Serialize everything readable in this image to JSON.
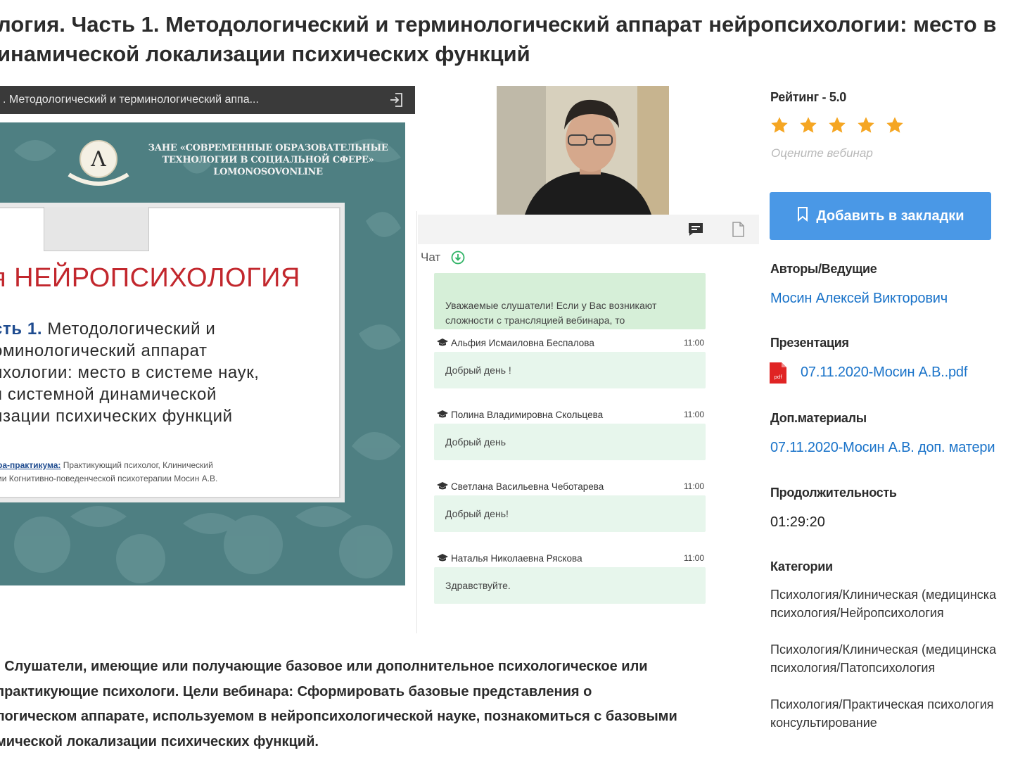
{
  "title": {
    "line1": "логия. Часть 1. Методологический и терминологический аппарат нейропсихологии: место в",
    "line2": "инамической локализации психических функций"
  },
  "player": {
    "bar_title": ". Методологический и терминологический аппа...",
    "slide": {
      "org_text": "ЗАНЕ «СОВРЕМЕННЫЕ ОБРАЗОВАТЕЛЬНЫЕ\nТЕХНОЛОГИИ В СОЦИАЛЬНОЙ СФЕРЕ»\nLOMONOSOVONLINE",
      "big_title": "я НЕЙРОПСИХОЛОГИЯ",
      "part_label": "сть 1.",
      "subtitle_rest": " Методологический и\nоминологический аппарат\nихологии: место в системе наук,\nя системной динамической\nизации психических функций",
      "author_label": "ра-практикума:",
      "author_text": " Практикующий психолог, Клинический\nии Когнитивно-поведенческой психотерапии Мосин А.В."
    }
  },
  "chat": {
    "label": "Чат",
    "system_message": "Уважаемые слушатели! Если у Вас возникают сложности с трансляцией вебинара, то",
    "messages": [
      {
        "author": "Альфия Исмаиловна Беспалова",
        "time": "11:00",
        "text": "Добрый день !"
      },
      {
        "author": "Полина Владимировна Скольцева",
        "time": "11:00",
        "text": "Добрый день"
      },
      {
        "author": "Светлана Васильевна Чеботарева",
        "time": "11:00",
        "text": "Добрый день!"
      },
      {
        "author": "Наталья Николаевна Рясковa",
        "time": "11:00",
        "text": "Здравствуйте."
      }
    ]
  },
  "sidebar": {
    "rating_label": "Рейтинг - 5.0",
    "rating_value": 5,
    "rating_max": 5,
    "rate_hint": "Оцените вебинар",
    "bookmark_label": "Добавить в закладки",
    "authors_heading": "Авторы/Ведущие",
    "author_name": "Мосин Алексей Викторович",
    "presentation_heading": "Презентация",
    "presentation_file": "07.11.2020-Мосин А.В..pdf",
    "extra_heading": "Доп.материалы",
    "extra_link": "07.11.2020-Мосин А.В. доп. матери",
    "duration_heading": "Продолжительность",
    "duration_value": "01:29:20",
    "categories_heading": "Категории",
    "categories": [
      "Психология/Клиническая (медицинска\nпсихология/Нейропсихология",
      "Психология/Клиническая (медицинска\nпсихология/Патопсихология",
      "Психология/Практическая психология\nконсультирование"
    ]
  },
  "description": ": Слушатели, имеющие или получающие базовое или дополнительное психологическое или\n практикующие психологи. Цели вебинара: Сформировать базовые представления о\nлогическом аппарате, используемом в нейропсихологической науке, познакомиться с базовыми\nмической локализации психических функций.",
  "colors": {
    "accent_blue": "#4a98e6",
    "link_blue": "#1a73c9",
    "star": "#f5a623",
    "chat_bubble": "#e7f6ec",
    "slide_teal": "#4e7f82",
    "slide_red": "#c2272d"
  }
}
